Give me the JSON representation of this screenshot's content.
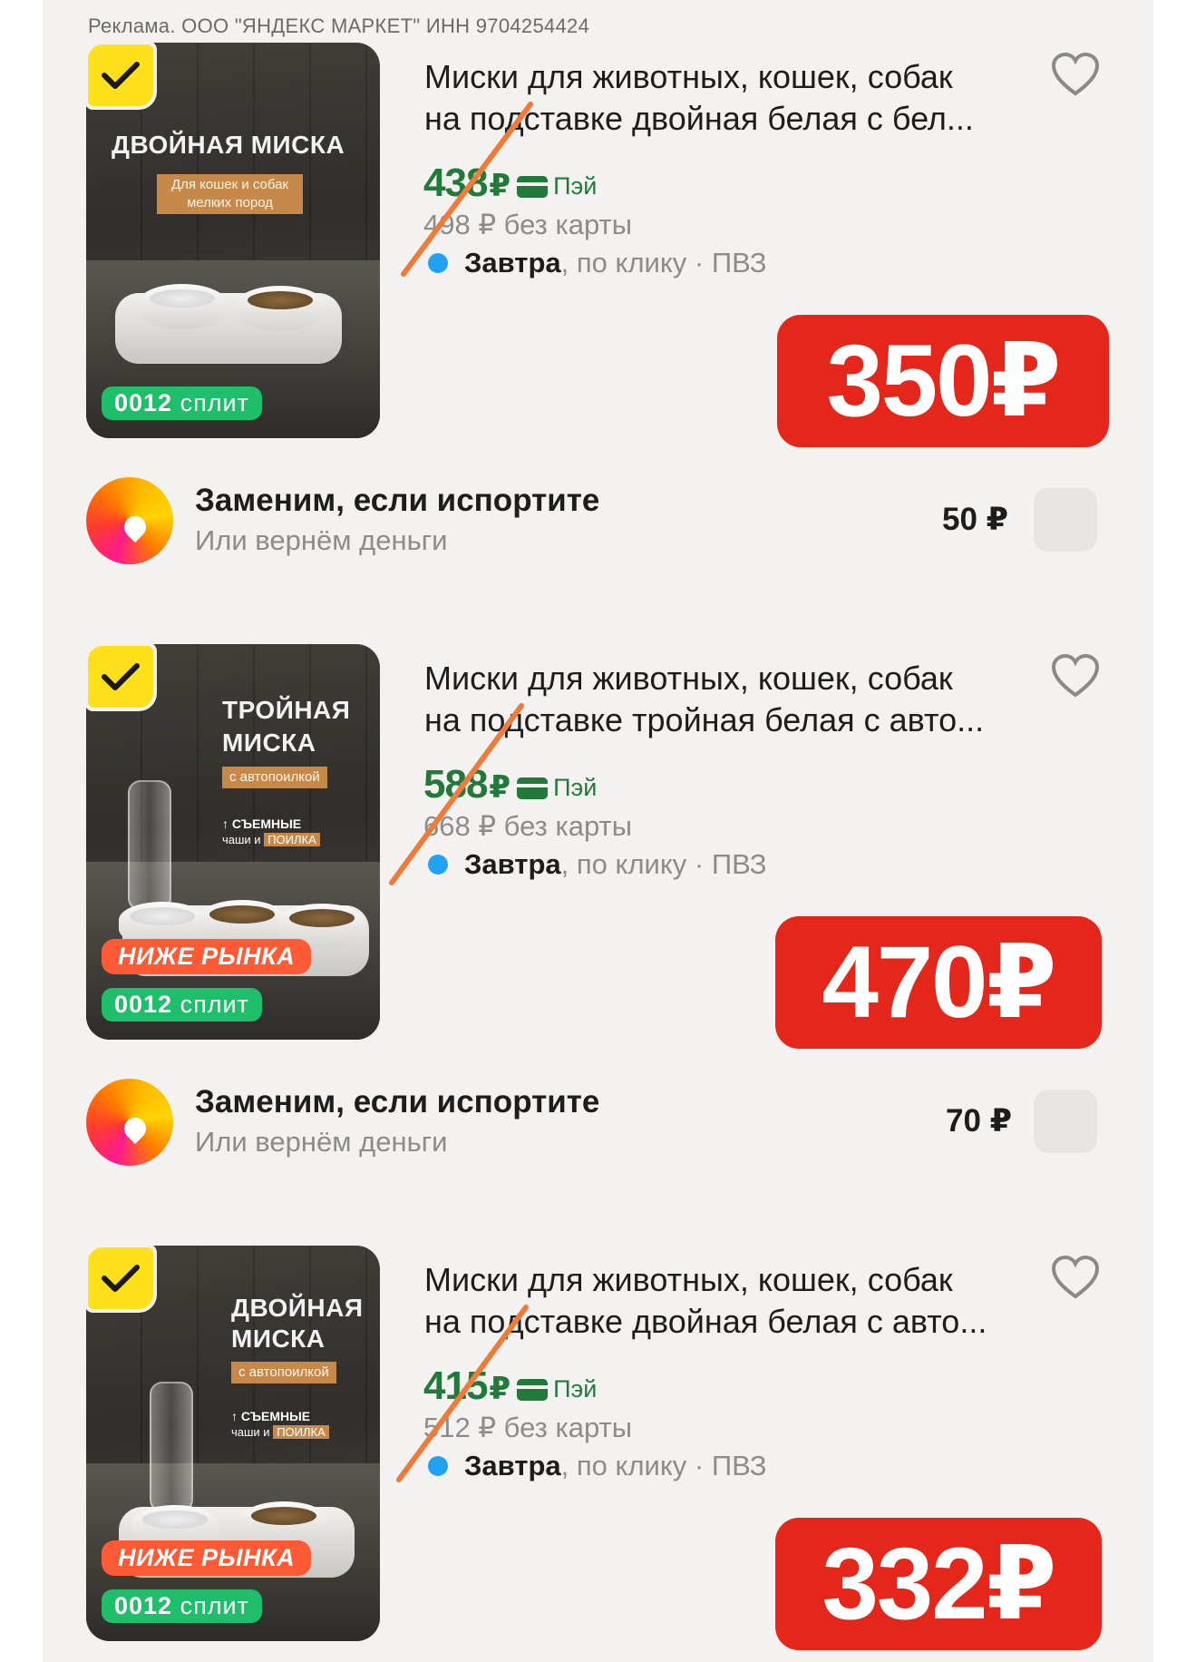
{
  "ad_note": "Реклама. ООО \"ЯНДЕКС МАРКЕТ\" ИНН 9704254424",
  "products": [
    {
      "title_line1": "Миски для животных, кошек, собак",
      "title_line2": "на подставке двойная белая с бел...",
      "price": "438",
      "currency": "₽",
      "pay_label": "Пэй",
      "old_price": "498 ₽ без карты",
      "delivery_day": "Завтра",
      "delivery_rest": ", по клику · ПВЗ",
      "promo_price": "350₽",
      "image_headline": "ДВОЙНАЯ МИСКА",
      "image_tag": "Для кошек и собак мелких пород",
      "split_number": "0012",
      "split_label": "сплит",
      "icons": [
        "check-icon",
        "heart-icon",
        "pay-card-icon"
      ]
    },
    {
      "title_line1": "Миски для животных, кошек, собак",
      "title_line2": "на подставке тройная белая с авто...",
      "price": "588",
      "currency": "₽",
      "pay_label": "Пэй",
      "old_price": "668 ₽ без карты",
      "delivery_day": "Завтра",
      "delivery_rest": ", по клику · ПВЗ",
      "promo_price": "470₽",
      "image_headline_1": "ТРОЙНАЯ",
      "image_headline_2": "МИСКА",
      "image_tag": "с автопоилкой",
      "feature_1": "СЪЕМНЫЕ",
      "feature_2": "чаши и",
      "feature_3": "ПОИЛКА",
      "low_badge": "НИЖЕ РЫНКА",
      "split_number": "0012",
      "split_label": "сплит"
    },
    {
      "title_line1": "Миски для животных, кошек, собак",
      "title_line2": "на подставке двойная белая с авто...",
      "price": "415",
      "currency": "₽",
      "pay_label": "Пэй",
      "old_price": "512 ₽ без карты",
      "delivery_day": "Завтра",
      "delivery_rest": ", по клику · ПВЗ",
      "promo_price": "332₽",
      "image_headline_1": "ДВОЙНАЯ",
      "image_headline_2": "МИСКА",
      "image_tag": "с автопоилкой",
      "feature_1": "СЪЕМНЫЕ",
      "feature_2": "чаши и",
      "feature_3": "ПОИЛКА",
      "low_badge": "НИЖЕ РЫНКА",
      "split_number": "0012",
      "split_label": "сплит"
    }
  ],
  "services": [
    {
      "title": "Заменим, если испортите",
      "subtitle": "Или вернём деньги",
      "fee": "50 ₽"
    },
    {
      "title": "Заменим, если испортите",
      "subtitle": "Или вернём деньги",
      "fee": "70 ₽"
    }
  ],
  "colors": {
    "accent_red": "#e5271b",
    "price_green": "#217a3a",
    "check_yellow": "#ffe01a",
    "split_green": "#1fbe6a",
    "delivery_blue": "#22a2f2",
    "strike_orange": "#f07a3a"
  }
}
